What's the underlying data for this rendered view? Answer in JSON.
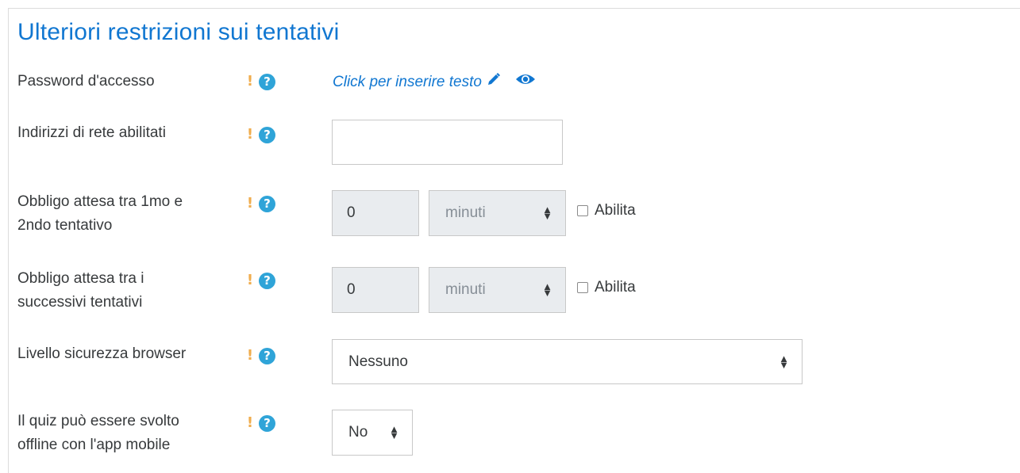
{
  "section": {
    "title": "Ulteriori restrizioni sui tentativi"
  },
  "icons": {
    "advanced": "!",
    "help": "?"
  },
  "colors": {
    "accent": "#1177d1",
    "help_icon": "#2fa4d8",
    "advanced_icon": "#f0ad4e"
  },
  "rows": {
    "password": {
      "label": "Password d'accesso",
      "value": "Click per inserire testo",
      "edit_icon": "pencil-icon",
      "reveal_icon": "eye-icon"
    },
    "network": {
      "label": "Indirizzi di rete abilitati",
      "value": ""
    },
    "delay1": {
      "label_line1": "Obbligo attesa tra 1mo e",
      "label_line2": "2ndo tentativo",
      "value": "0",
      "unit": "minuti",
      "enable_label": "Abilita",
      "enabled": false
    },
    "delay2": {
      "label_line1": "Obbligo attesa tra i",
      "label_line2": "successivi tentativi",
      "value": "0",
      "unit": "minuti",
      "enable_label": "Abilita",
      "enabled": false
    },
    "browser": {
      "label": "Livello sicurezza browser",
      "selected": "Nessuno"
    },
    "offline": {
      "label_line1": "Il quiz può essere svolto",
      "label_line2": "offline con l'app mobile",
      "selected": "No"
    }
  }
}
